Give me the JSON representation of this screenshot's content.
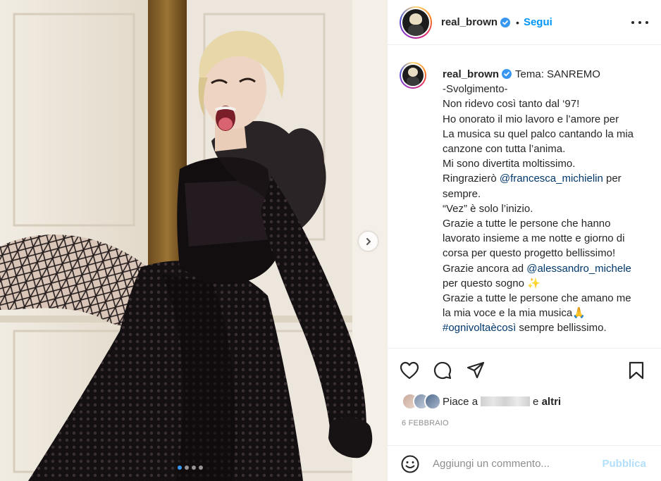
{
  "post": {
    "image_alt": "",
    "carousel": {
      "count": 4,
      "active": 0
    }
  },
  "header": {
    "username": "real_brown",
    "separator": "•",
    "follow_label": "Segui"
  },
  "caption": {
    "username": "real_brown",
    "lines": [
      {
        "parts": [
          {
            "t": "Tema: SANREMO"
          }
        ]
      },
      {
        "parts": [
          {
            "t": "-Svolgimento-"
          }
        ]
      },
      {
        "parts": [
          {
            "t": "Non ridevo così tanto dal ‘97!"
          }
        ]
      },
      {
        "parts": [
          {
            "t": "Ho onorato il mio lavoro e l’amore per"
          }
        ]
      },
      {
        "parts": [
          {
            "t": "La musica su quel palco cantando la mia"
          }
        ]
      },
      {
        "parts": [
          {
            "t": "canzone con tutta l’anima."
          }
        ]
      },
      {
        "parts": [
          {
            "t": "Mi sono divertita moltissimo."
          }
        ]
      },
      {
        "parts": [
          {
            "t": "Ringrazierò "
          },
          {
            "t": "@francesca_michielin",
            "mention": true
          },
          {
            "t": " per"
          }
        ]
      },
      {
        "parts": [
          {
            "t": "sempre."
          }
        ]
      },
      {
        "parts": [
          {
            "t": "“Vez” è solo l’inizio."
          }
        ]
      },
      {
        "parts": [
          {
            "t": "Grazie a tutte le persone che hanno"
          }
        ]
      },
      {
        "parts": [
          {
            "t": "lavorato insieme a me notte e giorno di"
          }
        ]
      },
      {
        "parts": [
          {
            "t": "corsa per questo progetto bellissimo!"
          }
        ]
      },
      {
        "parts": [
          {
            "t": "Grazie ancora ad "
          },
          {
            "t": "@alessandro_michele",
            "mention": true
          }
        ]
      },
      {
        "parts": [
          {
            "t": "per questo sogno ✨"
          }
        ]
      },
      {
        "parts": [
          {
            "t": "Grazie a tutte le persone che amano me"
          }
        ]
      },
      {
        "parts": [
          {
            "t": "la mia voce e la mia musica🙏"
          }
        ]
      },
      {
        "parts": [
          {
            "t": "#ognivoltaècosì",
            "mention": true
          },
          {
            "t": " sempre bellissimo."
          }
        ]
      }
    ]
  },
  "actions": {
    "likes_prefix": "Piace a",
    "likes_conjunction": "e",
    "likes_suffix": "altri",
    "date": "6 FEBBRAIO"
  },
  "comment": {
    "placeholder": "Aggiungi un commento...",
    "publish_label": "Pubblica"
  },
  "colors": {
    "link": "#0095f6",
    "mention": "#00376b",
    "publish_disabled": "#b2dffc",
    "muted": "#8e8e8e"
  }
}
